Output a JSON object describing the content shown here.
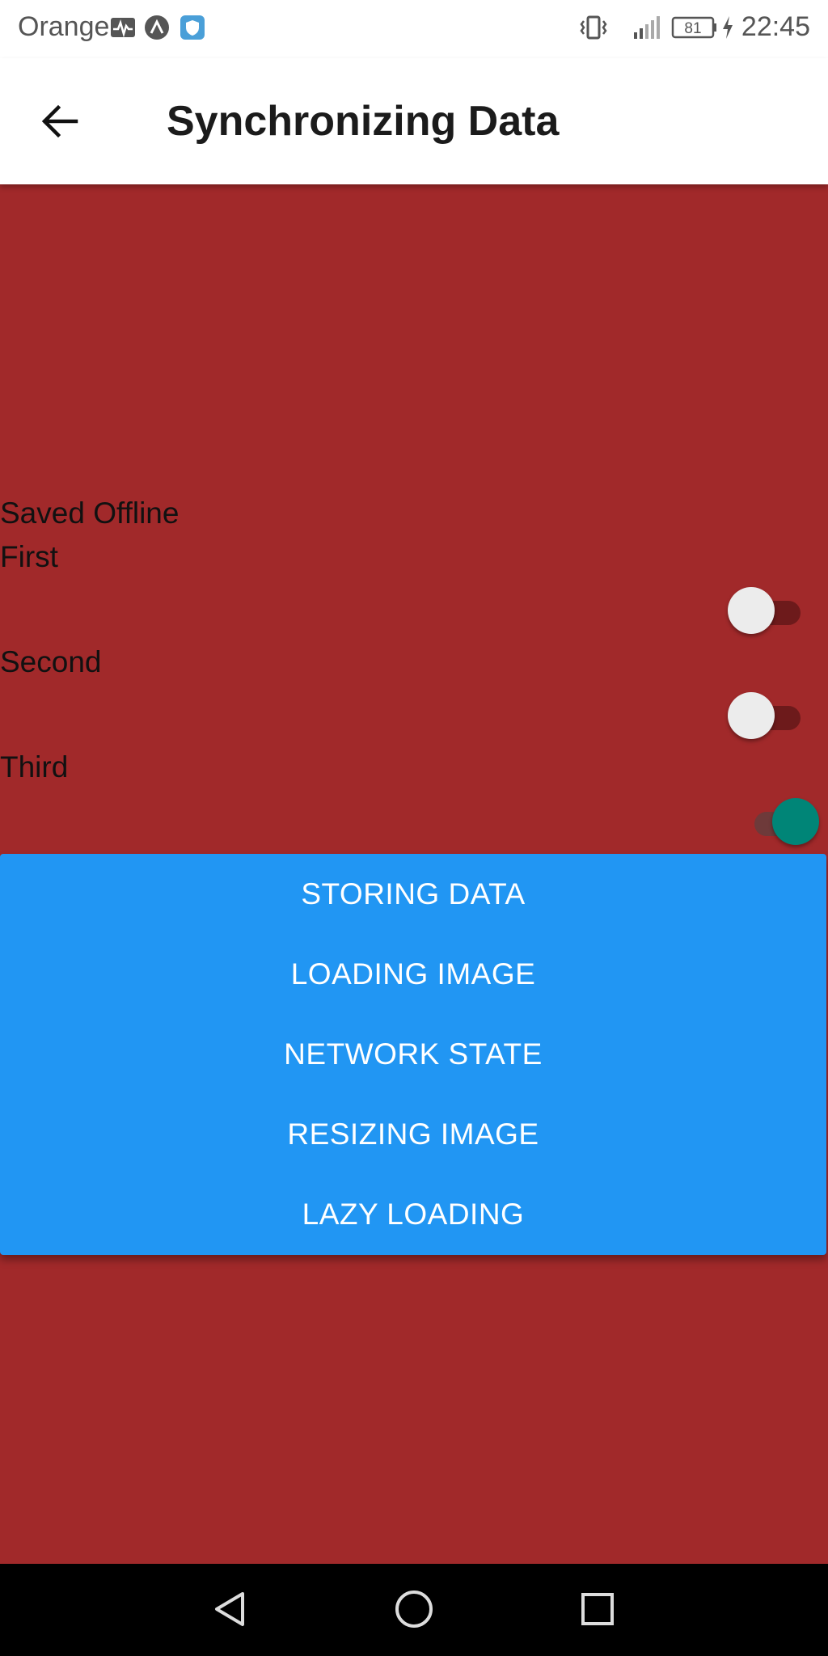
{
  "status_bar": {
    "carrier": "Orange",
    "battery": "81",
    "time": "22:45",
    "icons": [
      "activity-icon",
      "app-a-icon",
      "shield-icon",
      "vibrate-icon",
      "signal-icon",
      "battery-icon",
      "charging-icon"
    ]
  },
  "app_bar": {
    "title": "Synchronizing Data",
    "back_icon": "arrow-left-icon"
  },
  "content": {
    "header_label": "Saved Offline",
    "items": [
      {
        "label": "First",
        "switch_on": false
      },
      {
        "label": "Second",
        "switch_on": false
      },
      {
        "label": "Third",
        "switch_on": true
      }
    ]
  },
  "buttons": [
    {
      "label": "STORING DATA"
    },
    {
      "label": "LOADING IMAGE"
    },
    {
      "label": "NETWORK STATE"
    },
    {
      "label": "RESIZING IMAGE"
    },
    {
      "label": "LAZY LOADING"
    }
  ],
  "nav_bar": {
    "icons": [
      "back-triangle-icon",
      "home-circle-icon",
      "recents-square-icon"
    ]
  },
  "colors": {
    "background": "#a1292a",
    "button_panel": "#2196f3",
    "switch_on": "#008577",
    "switch_off_thumb": "#ececec"
  }
}
